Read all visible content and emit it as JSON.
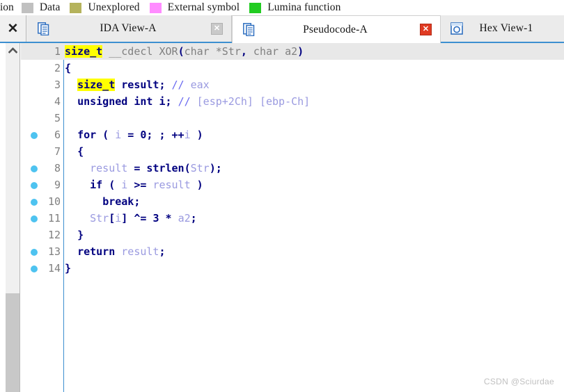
{
  "legend": {
    "clipped_label": "ion",
    "items": [
      {
        "label": "Data",
        "color": "#c0c0c0"
      },
      {
        "label": "Unexplored",
        "color": "#b5b35c"
      },
      {
        "label": "External symbol",
        "color": "#ff8cff"
      },
      {
        "label": "Lumina function",
        "color": "#22cc22"
      }
    ]
  },
  "tabs": {
    "close_all_label": "✕",
    "items": [
      {
        "title": "IDA View-A",
        "icon": "document-icon",
        "active": false,
        "close_label": "✕"
      },
      {
        "title": "Pseudocode-A",
        "icon": "document-icon",
        "active": true,
        "close_label": "✕"
      },
      {
        "title": "Hex View-1",
        "icon": "hexview-icon",
        "active": false,
        "close_label": ""
      }
    ]
  },
  "scrollbar": {
    "up_arrow": "▲"
  },
  "code": {
    "lines": [
      {
        "number": "1",
        "dot": false,
        "current": true,
        "tokens": [
          {
            "text": "size_t",
            "cls": "tk-type tk-hl"
          },
          {
            "text": " __cdecl XOR",
            "cls": "tk-plain"
          },
          {
            "text": "(",
            "cls": "tk-punc"
          },
          {
            "text": "char *Str",
            "cls": "tk-plain"
          },
          {
            "text": ",",
            "cls": "tk-punc"
          },
          {
            "text": " char a2",
            "cls": "tk-plain"
          },
          {
            "text": ")",
            "cls": "tk-punc"
          }
        ]
      },
      {
        "number": "2",
        "dot": false,
        "current": false,
        "tokens": [
          {
            "text": "{",
            "cls": "tk-brace"
          }
        ]
      },
      {
        "number": "3",
        "dot": false,
        "current": false,
        "tokens": [
          {
            "text": "  ",
            "cls": "tk-plain"
          },
          {
            "text": "size_t",
            "cls": "tk-type tk-hl"
          },
          {
            "text": " ",
            "cls": "tk-plain"
          },
          {
            "text": "result",
            "cls": "tk-kw"
          },
          {
            "text": ";",
            "cls": "tk-punc"
          },
          {
            "text": " ",
            "cls": "tk-plain"
          },
          {
            "text": "// ",
            "cls": "tk-comment"
          },
          {
            "text": "eax",
            "cls": "tk-var"
          }
        ]
      },
      {
        "number": "4",
        "dot": false,
        "current": false,
        "tokens": [
          {
            "text": "  ",
            "cls": "tk-plain"
          },
          {
            "text": "unsigned int",
            "cls": "tk-kw"
          },
          {
            "text": " ",
            "cls": "tk-plain"
          },
          {
            "text": "i",
            "cls": "tk-kw"
          },
          {
            "text": ";",
            "cls": "tk-punc"
          },
          {
            "text": " ",
            "cls": "tk-plain"
          },
          {
            "text": "// ",
            "cls": "tk-comment"
          },
          {
            "text": "[esp+2Ch] [ebp-Ch]",
            "cls": "tk-var"
          }
        ]
      },
      {
        "number": "5",
        "dot": false,
        "current": false,
        "tokens": []
      },
      {
        "number": "6",
        "dot": true,
        "current": false,
        "tokens": [
          {
            "text": "  ",
            "cls": "tk-plain"
          },
          {
            "text": "for",
            "cls": "tk-kw"
          },
          {
            "text": " ( ",
            "cls": "tk-punc"
          },
          {
            "text": "i",
            "cls": "tk-var"
          },
          {
            "text": " = ",
            "cls": "tk-punc"
          },
          {
            "text": "0",
            "cls": "tk-num"
          },
          {
            "text": "; ; ",
            "cls": "tk-punc"
          },
          {
            "text": "++",
            "cls": "tk-punc"
          },
          {
            "text": "i",
            "cls": "tk-var"
          },
          {
            "text": " )",
            "cls": "tk-punc"
          }
        ]
      },
      {
        "number": "7",
        "dot": false,
        "current": false,
        "tokens": [
          {
            "text": "  ",
            "cls": "tk-plain"
          },
          {
            "text": "{",
            "cls": "tk-brace"
          }
        ]
      },
      {
        "number": "8",
        "dot": true,
        "current": false,
        "tokens": [
          {
            "text": "    ",
            "cls": "tk-plain"
          },
          {
            "text": "result",
            "cls": "tk-var"
          },
          {
            "text": " = ",
            "cls": "tk-punc"
          },
          {
            "text": "strlen",
            "cls": "tk-fn"
          },
          {
            "text": "(",
            "cls": "tk-punc"
          },
          {
            "text": "Str",
            "cls": "tk-var"
          },
          {
            "text": ");",
            "cls": "tk-punc"
          }
        ]
      },
      {
        "number": "9",
        "dot": true,
        "current": false,
        "tokens": [
          {
            "text": "    ",
            "cls": "tk-plain"
          },
          {
            "text": "if",
            "cls": "tk-kw"
          },
          {
            "text": " ( ",
            "cls": "tk-punc"
          },
          {
            "text": "i",
            "cls": "tk-var"
          },
          {
            "text": " >= ",
            "cls": "tk-punc"
          },
          {
            "text": "result",
            "cls": "tk-var"
          },
          {
            "text": " )",
            "cls": "tk-punc"
          }
        ]
      },
      {
        "number": "10",
        "dot": true,
        "current": false,
        "tokens": [
          {
            "text": "      ",
            "cls": "tk-plain"
          },
          {
            "text": "break",
            "cls": "tk-kw"
          },
          {
            "text": ";",
            "cls": "tk-punc"
          }
        ]
      },
      {
        "number": "11",
        "dot": true,
        "current": false,
        "tokens": [
          {
            "text": "    ",
            "cls": "tk-plain"
          },
          {
            "text": "Str",
            "cls": "tk-var"
          },
          {
            "text": "[",
            "cls": "tk-punc"
          },
          {
            "text": "i",
            "cls": "tk-var"
          },
          {
            "text": "] ",
            "cls": "tk-punc"
          },
          {
            "text": "^= ",
            "cls": "tk-punc"
          },
          {
            "text": "3",
            "cls": "tk-num"
          },
          {
            "text": " * ",
            "cls": "tk-punc"
          },
          {
            "text": "a2",
            "cls": "tk-var"
          },
          {
            "text": ";",
            "cls": "tk-punc"
          }
        ]
      },
      {
        "number": "12",
        "dot": false,
        "current": false,
        "tokens": [
          {
            "text": "  ",
            "cls": "tk-plain"
          },
          {
            "text": "}",
            "cls": "tk-brace"
          }
        ]
      },
      {
        "number": "13",
        "dot": true,
        "current": false,
        "tokens": [
          {
            "text": "  ",
            "cls": "tk-plain"
          },
          {
            "text": "return",
            "cls": "tk-kw"
          },
          {
            "text": " ",
            "cls": "tk-plain"
          },
          {
            "text": "result",
            "cls": "tk-var"
          },
          {
            "text": ";",
            "cls": "tk-punc"
          }
        ]
      },
      {
        "number": "14",
        "dot": true,
        "current": false,
        "tokens": [
          {
            "text": "}",
            "cls": "tk-brace"
          }
        ]
      }
    ]
  },
  "watermark": "CSDN @Sciurdae"
}
